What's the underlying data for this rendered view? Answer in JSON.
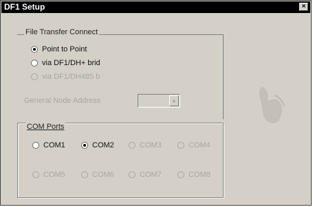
{
  "window": {
    "title": "DF1 Setup",
    "close_label": "×"
  },
  "file_transfer": {
    "legend": "File Transfer Connect",
    "options": [
      {
        "label": "Point to Point",
        "selected": true,
        "enabled": true
      },
      {
        "label": "via DF1/DH+ brid",
        "selected": false,
        "enabled": true
      },
      {
        "label": "via DF1/DH485 b",
        "selected": false,
        "enabled": false
      }
    ],
    "node_label": "General Node Address",
    "node_value": ""
  },
  "com_ports": {
    "legend": "COM Ports",
    "row1": [
      {
        "label": "COM1",
        "selected": false,
        "enabled": true
      },
      {
        "label": "COM2",
        "selected": true,
        "enabled": true
      },
      {
        "label": "COM3",
        "selected": false,
        "enabled": false
      },
      {
        "label": "COM4",
        "selected": false,
        "enabled": false
      }
    ],
    "row2": [
      {
        "label": "COM5",
        "selected": false,
        "enabled": false
      },
      {
        "label": "COM6",
        "selected": false,
        "enabled": false
      },
      {
        "label": "COM7",
        "selected": false,
        "enabled": false
      },
      {
        "label": "COM8",
        "selected": false,
        "enabled": false
      }
    ]
  },
  "logo": {
    "icon": "rockwell-logo-icon"
  }
}
